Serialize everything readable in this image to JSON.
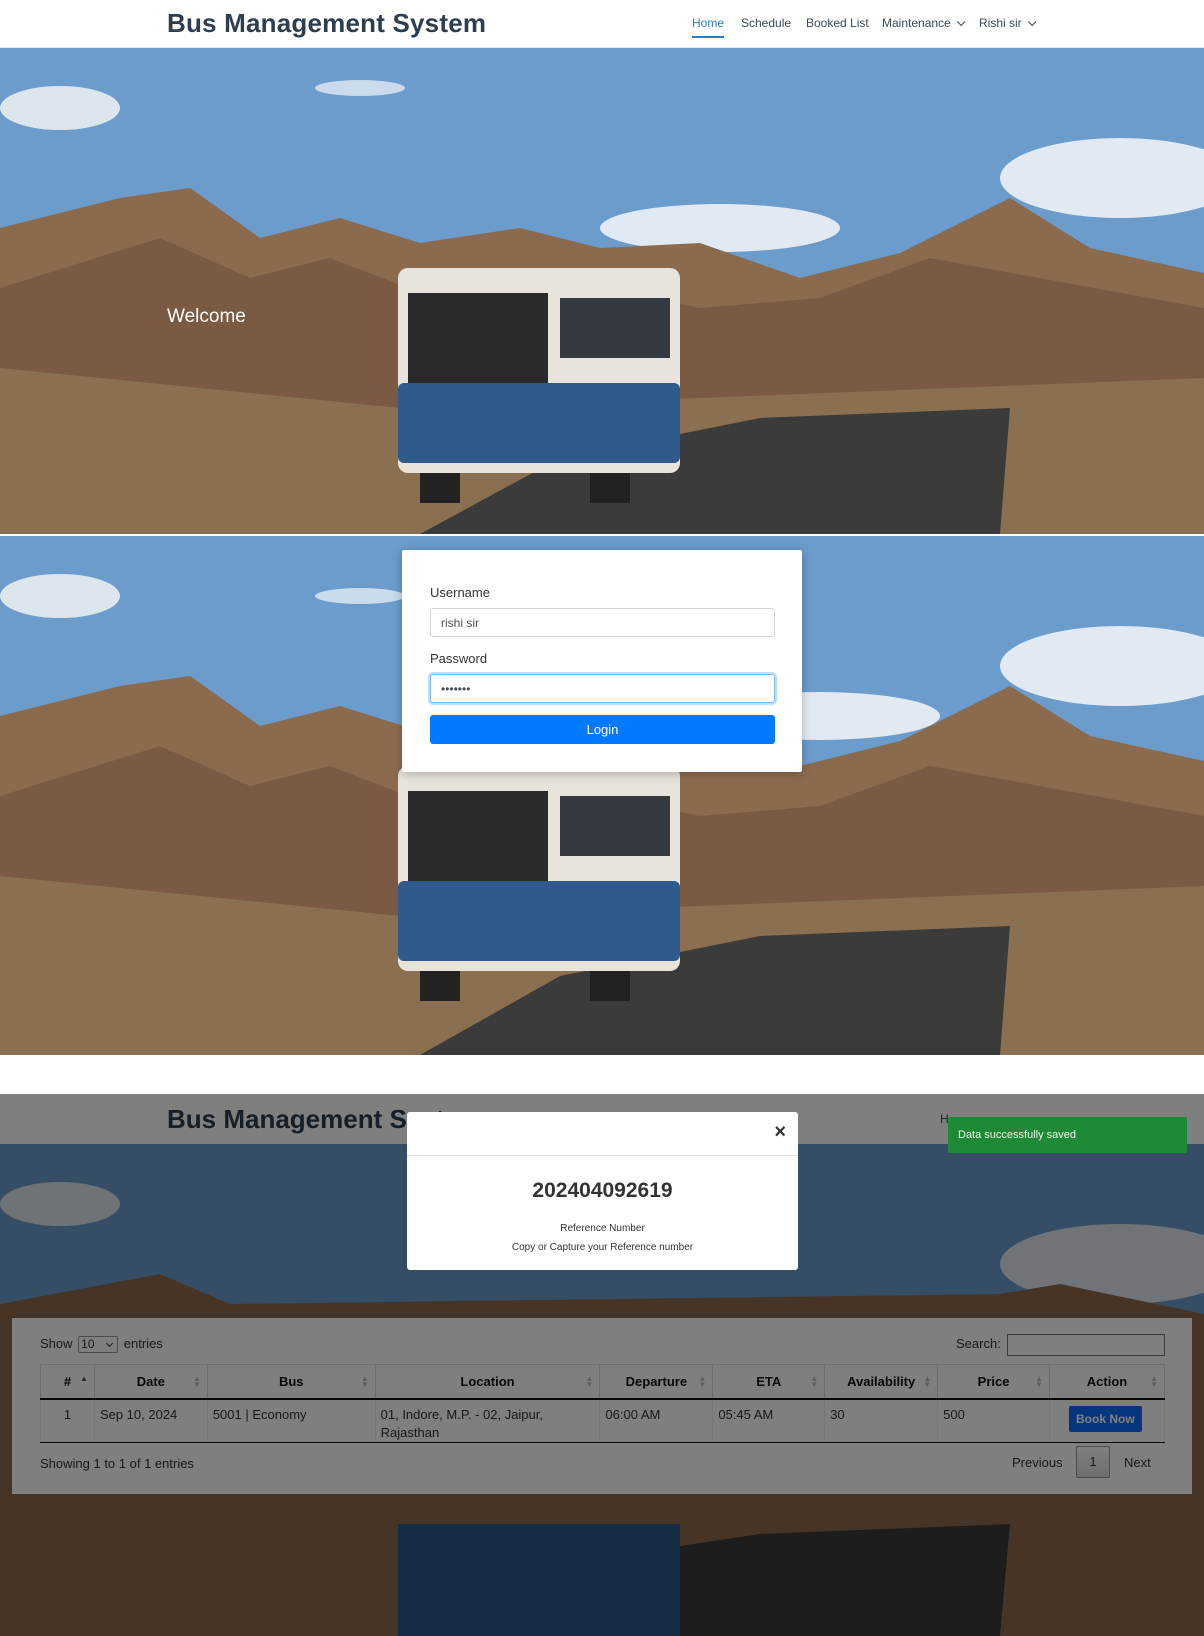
{
  "app": {
    "brand": "Bus Management System"
  },
  "nav": {
    "home": "Home",
    "schedule": "Schedule",
    "booked_list": "Booked List",
    "maintenance": "Maintenance",
    "user": "Rishi sir"
  },
  "hero": {
    "welcome": "Welcome"
  },
  "login": {
    "username_label": "Username",
    "username_value": "rishi sir",
    "password_label": "Password",
    "password_value": "•••••••",
    "submit_label": "Login"
  },
  "overlay_nav": {
    "partial": "H"
  },
  "modal": {
    "close_symbol": "×",
    "reference_number": "202404092619",
    "reference_label": "Reference Number",
    "hint": "Copy or Capture your Reference number"
  },
  "toast": {
    "message": "Data successfully saved",
    "color": "#1f8a36"
  },
  "table": {
    "show_label": "Show",
    "page_size": "10",
    "entries_label": "entries",
    "search_label": "Search:",
    "columns": [
      "#",
      "Date",
      "Bus",
      "Location",
      "Departure",
      "ETA",
      "Availability",
      "Price",
      "Action"
    ],
    "rows": [
      {
        "num": "1",
        "date": "Sep 10, 2024",
        "bus": "5001 | Economy",
        "location": "01, Indore, M.P. - 02, Jaipur, Rajasthan",
        "departure": "06:00 AM",
        "eta": "05:45 AM",
        "availability": "30",
        "price": "500",
        "action": "Book Now"
      }
    ],
    "info": "Showing 1 to 1 of 1 entries",
    "prev": "Previous",
    "page": "1",
    "next": "Next"
  },
  "colors": {
    "primary": "#007bff",
    "brand_text": "#2c3e50",
    "nav_active": "#2b7bc0"
  }
}
